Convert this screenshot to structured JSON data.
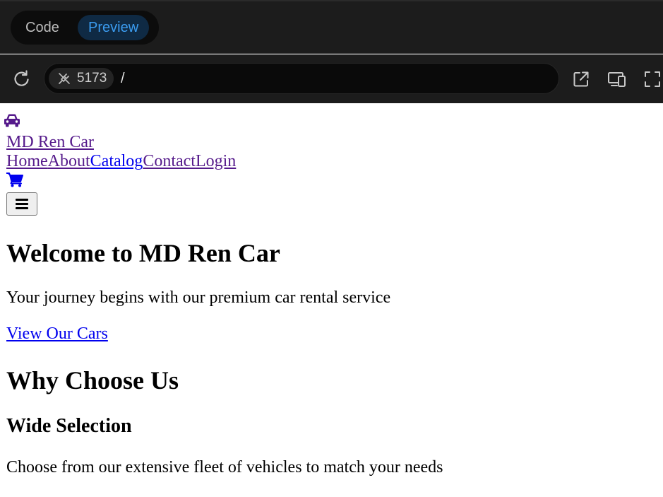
{
  "toolbar": {
    "mode_tabs": {
      "code": "Code",
      "preview": "Preview",
      "active": "Preview"
    },
    "address": {
      "port": "5173",
      "path": "/"
    },
    "icons": [
      "reload-icon",
      "plug-off-icon",
      "open-external-icon",
      "responsive-devices-icon",
      "fullscreen-icon"
    ],
    "colors": {
      "bar_bg": "#1c1c1c",
      "address_bg": "#0a0a0a",
      "active_tab_text": "#3b9cf0",
      "active_tab_bg": "#0f2a44"
    }
  },
  "site": {
    "brand": {
      "name": "MD Ren Car",
      "icon": "car-icon",
      "color": "#551a8b"
    },
    "nav": [
      {
        "label": "Home",
        "visited": true
      },
      {
        "label": "About",
        "visited": true
      },
      {
        "label": "Catalog",
        "visited": false
      },
      {
        "label": "Contact",
        "visited": true
      },
      {
        "label": "Login",
        "visited": true
      }
    ],
    "cart_icon": "shopping-cart-icon",
    "menu_icon": "hamburger-menu-icon",
    "hero": {
      "title": "Welcome to MD Ren Car",
      "subtitle": "Your journey begins with our premium car rental service",
      "cta": "View Our Cars"
    },
    "features": {
      "heading": "Why Choose Us",
      "items": [
        {
          "title": "Wide Selection",
          "description": "Choose from our extensive fleet of vehicles to match your needs"
        }
      ]
    },
    "colors": {
      "link": "#0000ee",
      "visited_link": "#551a8b"
    }
  }
}
